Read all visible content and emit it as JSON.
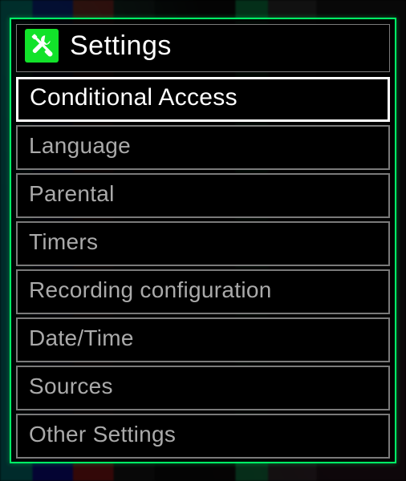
{
  "header": {
    "icon": "tools-icon",
    "title": "Settings"
  },
  "menu": {
    "items": [
      {
        "label": "Conditional Access",
        "selected": true
      },
      {
        "label": "Language",
        "selected": false
      },
      {
        "label": "Parental",
        "selected": false
      },
      {
        "label": "Timers",
        "selected": false
      },
      {
        "label": "Recording configuration",
        "selected": false
      },
      {
        "label": "Date/Time",
        "selected": false
      },
      {
        "label": "Sources",
        "selected": false
      },
      {
        "label": "Other Settings",
        "selected": false
      }
    ]
  },
  "colors": {
    "accent": "#00ff66",
    "iconBg": "#12e22a"
  }
}
